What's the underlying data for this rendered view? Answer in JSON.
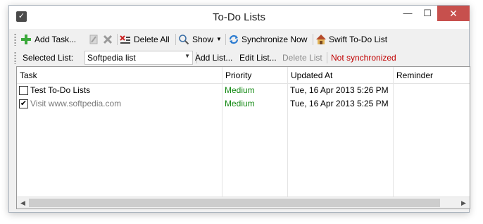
{
  "window": {
    "title": "To-Do Lists"
  },
  "titlebar_buttons": {
    "minimize": "—",
    "maximize": "☐",
    "close": "✕"
  },
  "toolbar": {
    "add_task": "Add Task...",
    "delete_all": "Delete All",
    "show": "Show",
    "synchronize_now": "Synchronize Now",
    "swift_todo_list": "Swift To-Do List"
  },
  "list_bar": {
    "selected_list_label": "Selected List:",
    "selected_list_value": "Softpedia list",
    "add_list": "Add List...",
    "edit_list": "Edit List...",
    "delete_list": "Delete List",
    "sync_status": "Not synchronized"
  },
  "table": {
    "columns": [
      "Task",
      "Priority",
      "Updated At",
      "Reminder"
    ],
    "rows": [
      {
        "checked": false,
        "task": "Test To-Do Lists",
        "priority": "Medium",
        "updated_at": "Tue, 16 Apr 2013 5:26 PM",
        "reminder": ""
      },
      {
        "checked": true,
        "task": "Visit www.softpedia.com",
        "priority": "Medium",
        "updated_at": "Tue, 16 Apr 2013 5:25 PM",
        "reminder": ""
      }
    ]
  },
  "colors": {
    "priority_text": "#158a15",
    "sync_status_text": "#c00000",
    "close_button": "#c7504d"
  }
}
